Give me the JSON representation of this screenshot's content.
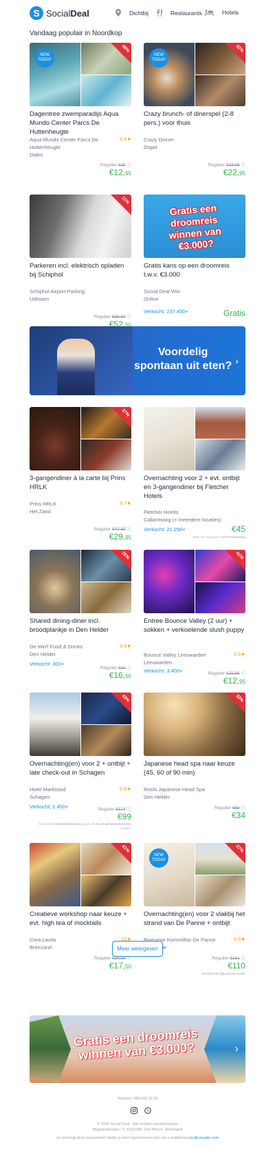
{
  "header": {
    "logo": {
      "text_a": "Social",
      "text_b": "Deal",
      "icon": "logo-icon"
    },
    "nav": [
      {
        "label": "Dichtbij",
        "icon": "location-pin-icon"
      },
      {
        "label": "Restaurants",
        "icon": "cutlery-icon"
      },
      {
        "label": "Hotels",
        "icon": "bed-icon"
      }
    ]
  },
  "section_title": "Vandaag populair in Noordkop",
  "colors": {
    "brand": "#1d8fe0",
    "price": "#2eb84b",
    "discount": "#e0303a",
    "rating": "#f2a515"
  },
  "deals": [
    {
      "title": "Dagentree zwemparadijs Aqua Mundo Center Parcs De Huttenheugte",
      "merchant": "Aqua Mundo Center Parcs De Huttenheugte",
      "location": "Dalen",
      "rating": "9.4★",
      "regular_label": "Regulier",
      "regular_price": "€25",
      "price_main": "€12,",
      "price_cents": "95",
      "discount": "48%",
      "badge": "NEW TODAY",
      "sold": "",
      "fine": ""
    },
    {
      "title": "Crazy brunch- of dinerspel (2-8 pers.) voor thuis",
      "merchant": "Crazy Dinner",
      "location": "Ospel",
      "rating": "",
      "regular_label": "Regulier",
      "regular_price": "€33,95",
      "price_main": "€22,",
      "price_cents": "95",
      "discount": "32%",
      "badge": "NEW TODAY",
      "sold": "",
      "fine": ""
    },
    {
      "title": "Parkeren incl. elektrisch opladen bij Schiphol",
      "merchant": "Schiphol Airport Parking",
      "location": "Uithoorn",
      "rating": "",
      "regular_label": "Regulier",
      "regular_price": "€58,90",
      "price_main": "€52,",
      "price_cents": "50",
      "discount": "11%",
      "badge": "",
      "sold": "",
      "fine": ""
    },
    {
      "title": "Gratis kans op een droomreis t.w.v. €3.000",
      "merchant": "Social Deal Win",
      "location": "Online",
      "rating": "",
      "regular_label": "",
      "regular_price": "",
      "price_main": "Gratis",
      "price_cents": "",
      "discount": "",
      "badge": "",
      "sold": "Verkocht: 237.450+",
      "fine": "",
      "promo_text": "Gratis een droomreis winnen van €3.000?"
    },
    {
      "title": "3-gangendiner à la carte bij Prins HRLK",
      "merchant": "Prins HRLK",
      "location": "Het Zand",
      "rating": "9.7★",
      "regular_label": "Regulier",
      "regular_price": "€47,55",
      "price_main": "€29,",
      "price_cents": "95",
      "discount": "37%",
      "badge": "",
      "sold": "",
      "fine": ""
    },
    {
      "title": "Overnachting voor 2 + evt. ontbijt en 3-gangendiner bij Fletcher Hotels",
      "merchant": "Fletcher Hotels",
      "location": "Callantsoog (+ meerdere locaties)",
      "rating": "",
      "regular_label": "",
      "regular_price": "",
      "price_main": "€45",
      "price_cents": "",
      "discount": "",
      "badge": "",
      "sold": "Verkocht: 21.250+",
      "fine": "Excl. ca. €3 p.p.p.n. toeristenbelasting"
    },
    {
      "title": "Shared dining-diner incl. broodplankje in Den Helder",
      "merchant": "De Werf Food & Drinks",
      "location": "Den Helder",
      "rating": "9.9★",
      "regular_label": "Regulier",
      "regular_price": "€22",
      "price_main": "€16,",
      "price_cents": "50",
      "discount": "25%",
      "badge": "",
      "sold": "Verkocht: 300+",
      "fine": ""
    },
    {
      "title": "Entree Bounce Valley (2 uur) + sokken + verkoelende slush puppy",
      "merchant": "Bounce Valley Leeuwarden",
      "location": "Leeuwarden",
      "rating": "9.5★",
      "regular_label": "Regulier",
      "regular_price": "€21,95",
      "price_main": "€12,",
      "price_cents": "95",
      "discount": "41%",
      "badge": "",
      "sold": "Verkocht: 3.400+",
      "fine": ""
    },
    {
      "title": "Overnachting(en) voor 2 + ontbijt + late check-out in Schagen",
      "merchant": "Hotel Marktstad",
      "location": "Schagen",
      "rating": "9.8★",
      "regular_label": "Regulier",
      "regular_price": "€174",
      "price_main": "€99",
      "price_cents": "",
      "discount": "43%",
      "badge": "",
      "sold": "Verkocht: 1.450+",
      "fine": "Excl. €2,50 toeristenbelasting p.p.p.n. en €1,43 administratiekosten p.p.p.n."
    },
    {
      "title": "Japanese head spa naar keuze (45, 60 of 90 min)",
      "merchant": "Roshi Japanese Head Spa",
      "location": "Den Helder",
      "rating": "",
      "regular_label": "Regulier",
      "regular_price": "€50",
      "price_main": "€34",
      "price_cents": "",
      "discount": "32%",
      "badge": "",
      "sold": "",
      "fine": ""
    },
    {
      "title": "Creatieve workshop naar keuze + evt. high tea of mocktails",
      "merchant": "Crea Lavita",
      "location": "Breezand",
      "rating": "10★",
      "regular_label": "Regulier",
      "regular_price": "€29,50",
      "price_main": "€17,",
      "price_cents": "50",
      "discount": "41%",
      "badge": "",
      "sold": "",
      "fine": ""
    },
    {
      "title": "Overnachting(en) voor 2 vlakbij het strand van De Panne + ontbijt",
      "merchant": "Brasserie Kommilfoo De Panne",
      "location": "De Panne",
      "rating": "9.6★",
      "regular_label": "Regulier",
      "regular_price": "€151",
      "price_main": "€110",
      "price_cents": "",
      "discount": "27%",
      "badge": "NEW TODAY",
      "sold": "",
      "fine": "Inclusief alle bijkomende kosten"
    }
  ],
  "mid_banner": {
    "line1": "Voordelig",
    "line2": "spontaan uit eten?",
    "icon": "chevron-right-icon"
  },
  "more_button": "Meer weergeven",
  "bottom_banner": {
    "text": "Gratis een droomreis winnen van €3.000?",
    "icon": "chevron-right-icon"
  },
  "footer": {
    "phone": "Telefoon: 088-205 05 05",
    "social_icons": [
      "instagram-icon",
      "whatsapp-icon"
    ],
    "copyright": "© 2026 Social Deal - Alle rechten voorbehouden",
    "address": "Magistratenlaan 72, 5223 MD, Den Bosch, Nederland",
    "subscribe_text": "Je ontvangt deze nieuwsbrief omdat je bent ingeschreven met het e-mailadres",
    "email": "xxx@ureader.com"
  }
}
